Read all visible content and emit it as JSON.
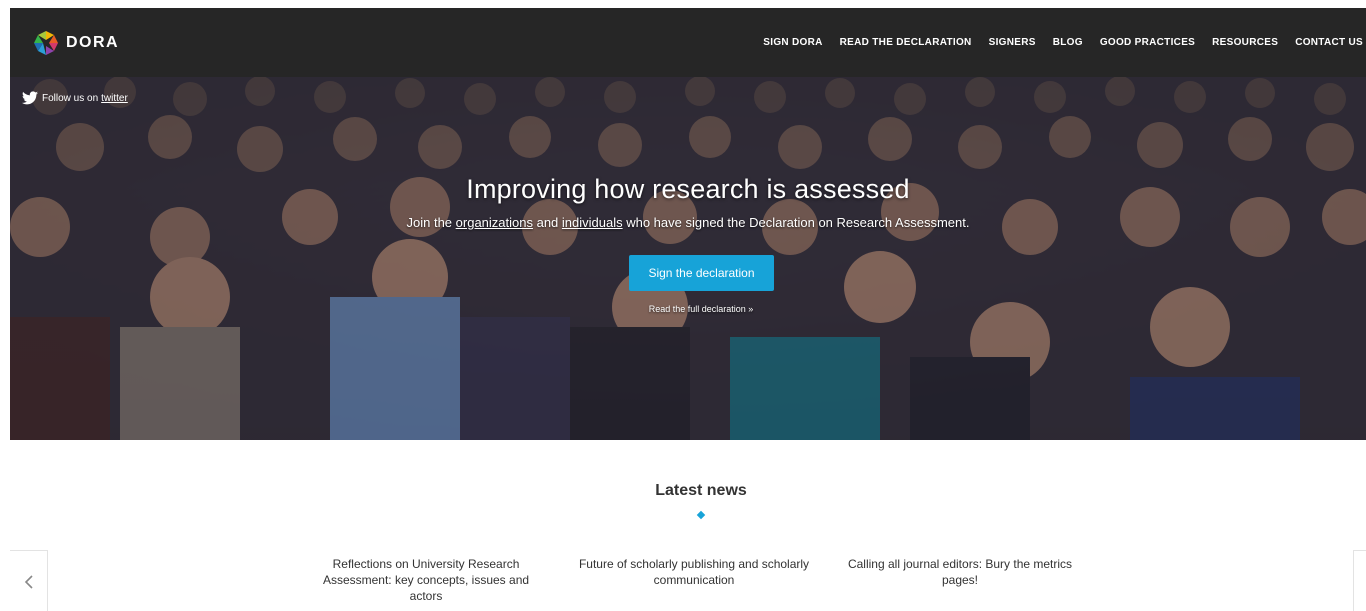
{
  "brand": {
    "name": "DORA",
    "logo_icon": "dora-logo-icon"
  },
  "nav": {
    "items": [
      {
        "label": "SIGN DORA"
      },
      {
        "label": "READ THE DECLARATION"
      },
      {
        "label": "SIGNERS"
      },
      {
        "label": "BLOG"
      },
      {
        "label": "GOOD PRACTICES"
      },
      {
        "label": "RESOURCES"
      },
      {
        "label": "CONTACT US"
      }
    ]
  },
  "hero": {
    "follow_prefix": "Follow us on",
    "follow_link": "twitter",
    "title": "Improving how research is assessed",
    "subtitle": {
      "part1": "Join the ",
      "link1": "organizations",
      "part2": " and ",
      "link2": "individuals",
      "part3": " who have signed the Declaration on Research Assessment."
    },
    "cta_label": "Sign the declaration",
    "read_full": "Read the full declaration »"
  },
  "news": {
    "heading": "Latest news",
    "items": [
      {
        "title": "Reflections on University Research Assessment: key concepts, issues and actors"
      },
      {
        "title": "Future of scholarly publishing and scholarly communication"
      },
      {
        "title": "Calling all journal editors: Bury the metrics pages!"
      }
    ],
    "prev_icon": "chevron-left-icon"
  },
  "colors": {
    "navbar": "#262626",
    "accent": "#17a3d8",
    "text": "#333333"
  }
}
